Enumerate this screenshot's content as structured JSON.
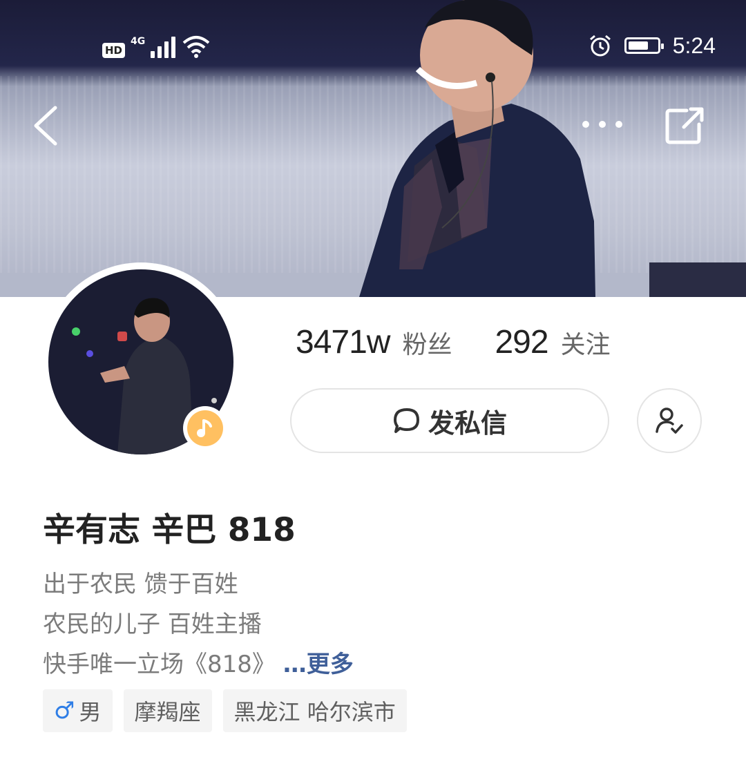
{
  "status_bar": {
    "hd": "HD",
    "network": "4G",
    "time": "5:24",
    "wifi_badge": "4+"
  },
  "header": {
    "back_icon": "chevron-left-icon",
    "more_icon": "more-dots-icon",
    "share_icon": "share-external-icon"
  },
  "profile": {
    "followers_count": "3471w",
    "followers_label": "粉丝",
    "following_count": "292",
    "following_label": "关注",
    "message_button": "发私信",
    "message_icon": "chat-bubble-icon",
    "follow_icon": "add-friend-icon",
    "avatar_badge_icon": "music-note-icon",
    "name": "辛有志 辛巴 818",
    "bio_line1": "出于农民 馈于百姓",
    "bio_line2": "农民的儿子  百姓主播",
    "bio_line3": "快手唯一立场《818》",
    "bio_more": "…更多"
  },
  "tags": {
    "gender_symbol": "♂",
    "gender": "男",
    "zodiac": "摩羯座",
    "location": "黑龙江 哈尔滨市"
  },
  "colors": {
    "accent_link": "#3f5f99",
    "badge_bg": "#ffc061",
    "gender_blue": "#2f7ee6",
    "tag_bg": "#f4f4f4"
  }
}
